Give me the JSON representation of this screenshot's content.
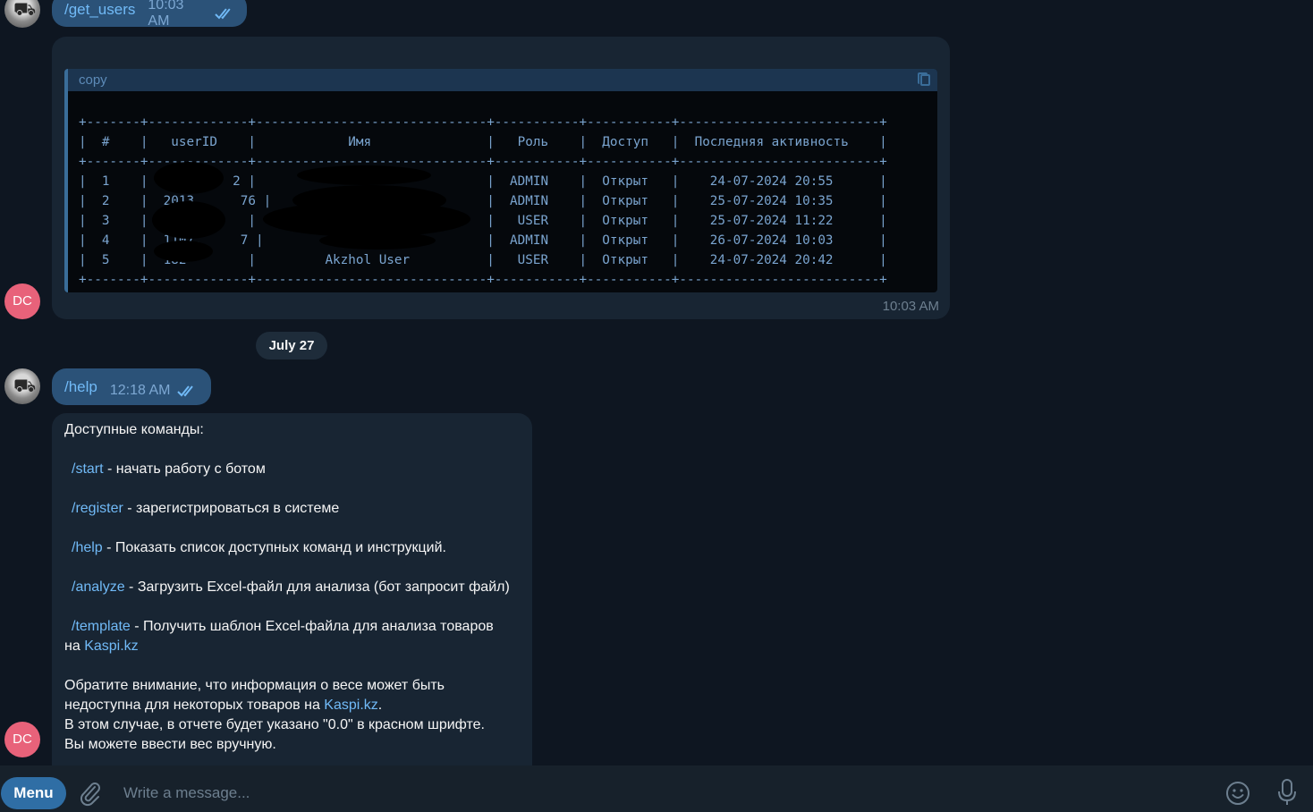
{
  "messages": {
    "first_out": {
      "command": "/get_users",
      "time": "10:03 AM"
    },
    "table_reply": {
      "code_header": "copy",
      "table_lines": [
        "+-------+-------------+------------------------------+-----------+-----------+--------------------------+",
        "|  #    |   userID    |            Имя               |   Роль    |  Доступ   |  Последняя активность    |",
        "+-------+-------------+------------------------------+-----------+-----------+--------------------------+",
        "|  1    |           2 |                              |  ADMIN    |  Открыт   |    24-07-2024 20:55      |",
        "|  2    |  2013      76 |                            |  ADMIN    |  Открыт   |    25-07-2024 10:35      |",
        "|  3    |             |                              |   USER    |  Открыт   |    25-07-2024 11:22      |",
        "|  4    |  1107.     7 |                             |  ADMIN    |  Открыт   |    26-07-2024 10:03      |",
        "|  5    |  182        |         Akzhol User          |   USER    |  Открыт   |    24-07-2024 20:42      |",
        "+-------+-------------+------------------------------+-----------+-----------+--------------------------+"
      ],
      "time": "10:03 AM"
    },
    "date_separator": "July 27",
    "second_out": {
      "command": "/help",
      "time": "12:18 AM"
    },
    "help_reply": {
      "heading": "Доступные команды:",
      "commands": [
        {
          "cmd": "/start",
          "desc": " - начать работу с ботом"
        },
        {
          "cmd": "/register",
          "desc": " - зарегистрироваться в системе"
        },
        {
          "cmd": "/help",
          "desc": " - Показать список доступных команд и инструкций."
        },
        {
          "cmd": "/analyze",
          "desc": " - Загрузить Excel-файл для анализа (бот запросит файл)"
        },
        {
          "cmd": "/template",
          "desc": " - Получить шаблон Excel-файла для анализа товаров"
        }
      ],
      "template_cont_prefix": "на ",
      "template_cont_link": "Kaspi.kz",
      "note_line1": "Обратите внимание, что информация о весе может быть",
      "note_line2_prefix": "недоступна для некоторых товаров на ",
      "note_line2_link": "Kaspi.kz",
      "note_line2_suffix": ".",
      "note_line3": "В этом случае, в отчете будет указано \"0.0\" в красном шрифте.",
      "note_line4": "Вы можете ввести вес вручную."
    }
  },
  "avatars": {
    "bot_initials": "DC"
  },
  "composer": {
    "menu_label": "Menu",
    "placeholder": "Write a message..."
  },
  "colors": {
    "background": "#0e1621",
    "outgoing": "#2b5278",
    "incoming": "#182533",
    "link": "#71baf7",
    "avatar_dc": "#e8627a"
  }
}
